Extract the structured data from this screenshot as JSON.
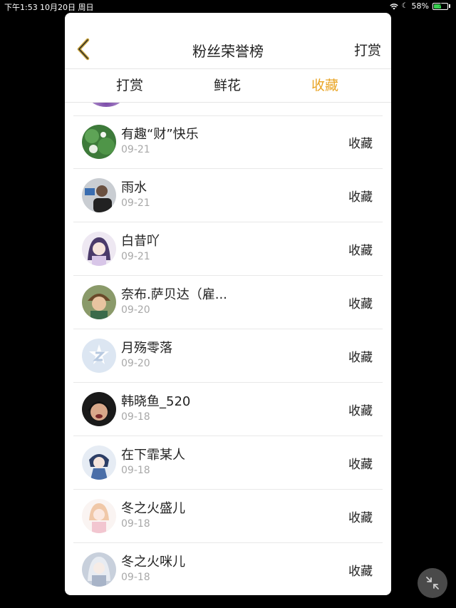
{
  "status": {
    "time": "下午1:53",
    "date": "10月20日 周日",
    "battery": "58%",
    "battery_level": 0.58
  },
  "header": {
    "title": "粉丝荣誉榜",
    "right_action": "打赏"
  },
  "tabs": [
    {
      "label": "打赏",
      "active": false
    },
    {
      "label": "鲜花",
      "active": false
    },
    {
      "label": "收藏",
      "active": true
    }
  ],
  "colors": {
    "accent": "#e9a526",
    "text": "#222222",
    "muted": "#a8a8a8"
  },
  "rows": [
    {
      "name": "有趣“财”快乐",
      "date": "09-21",
      "action": "收藏"
    },
    {
      "name": "雨水",
      "date": "09-21",
      "action": "收藏"
    },
    {
      "name": "白昔吖",
      "date": "09-21",
      "action": "收藏"
    },
    {
      "name": "奈布.萨贝达（雇...",
      "date": "09-20",
      "action": "收藏"
    },
    {
      "name": "月殇零落",
      "date": "09-20",
      "action": "收藏"
    },
    {
      "name": "韩晓鱼_520",
      "date": "09-18",
      "action": "收藏"
    },
    {
      "name": "在下霏某人",
      "date": "09-18",
      "action": "收藏"
    },
    {
      "name": "冬之火盛儿",
      "date": "09-18",
      "action": "收藏"
    },
    {
      "name": "冬之火咪儿",
      "date": "09-18",
      "action": "收藏"
    }
  ],
  "icons": {
    "back": "chevron-left-icon",
    "fab": "minimize-arrows-icon"
  }
}
